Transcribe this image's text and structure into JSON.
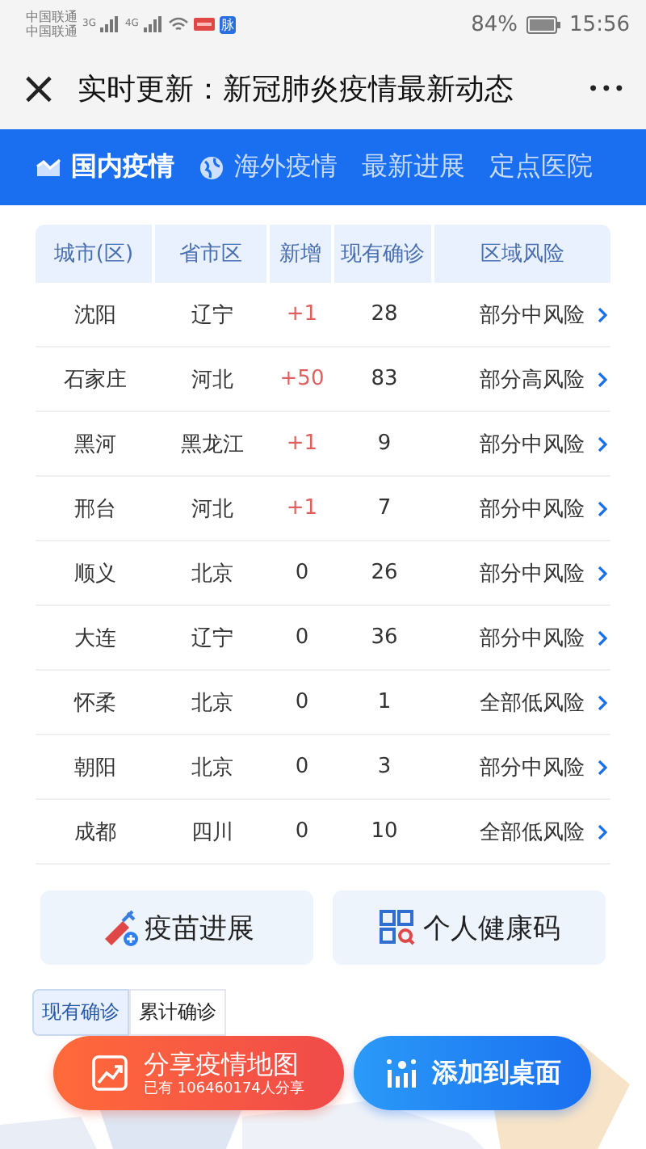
{
  "status_bar": {
    "carriers": [
      "中国联通",
      "中国联通"
    ],
    "networks": [
      "3G",
      "4G"
    ],
    "app_badge": "脉",
    "battery": "84%",
    "time": "15:56"
  },
  "title_bar": {
    "close": "×",
    "title": "实时更新：新冠肺炎疫情最新动态",
    "more": "•••"
  },
  "tabs": [
    {
      "label": "国内疫情",
      "kind": "chart",
      "selected": true
    },
    {
      "label": "海外疫情",
      "kind": "globe",
      "selected": false
    },
    {
      "label": "最新进展",
      "kind": "plain",
      "selected": false
    },
    {
      "label": "定点医院",
      "kind": "plain",
      "selected": false
    }
  ],
  "table": {
    "columns": [
      "城市(区)",
      "省市区",
      "新增",
      "现有确诊",
      "区域风险"
    ],
    "rows": [
      {
        "city": "沈阳",
        "province": "辽宁",
        "new": "+1",
        "color": "#e06060",
        "current": "28",
        "risk": "部分中风险"
      },
      {
        "city": "石家庄",
        "province": "河北",
        "new": "+50",
        "color": "#e06060",
        "current": "83",
        "risk": "部分高风险"
      },
      {
        "city": "黑河",
        "province": "黑龙江",
        "new": "+1",
        "color": "#e06060",
        "current": "9",
        "risk": "部分中风险"
      },
      {
        "city": "邢台",
        "province": "河北",
        "new": "+1",
        "color": "#e06060",
        "current": "7",
        "risk": "部分中风险"
      },
      {
        "city": "顺义",
        "province": "北京",
        "new": "0",
        "color": "#333333",
        "current": "26",
        "risk": "部分中风险"
      },
      {
        "city": "大连",
        "province": "辽宁",
        "new": "0",
        "color": "#333333",
        "current": "36",
        "risk": "部分中风险"
      },
      {
        "city": "怀柔",
        "province": "北京",
        "new": "0",
        "color": "#333333",
        "current": "1",
        "risk": "全部低风险"
      },
      {
        "city": "朝阳",
        "province": "北京",
        "new": "0",
        "color": "#333333",
        "current": "3",
        "risk": "部分中风险"
      },
      {
        "city": "成都",
        "province": "四川",
        "new": "0",
        "color": "#333333",
        "current": "10",
        "risk": "全部低风险"
      }
    ]
  },
  "shortcuts": [
    {
      "label": "疫苗进展",
      "kind": "vaccine"
    },
    {
      "label": "个人健康码",
      "kind": "qr"
    }
  ],
  "toggle": [
    {
      "label": "现有确诊",
      "selected": true
    },
    {
      "label": "累计确诊",
      "selected": false
    }
  ],
  "share_button": {
    "label": "分享疫情地图",
    "sub": "已有 106460174人分享"
  },
  "desktop_button": {
    "label": "添加到桌面"
  }
}
